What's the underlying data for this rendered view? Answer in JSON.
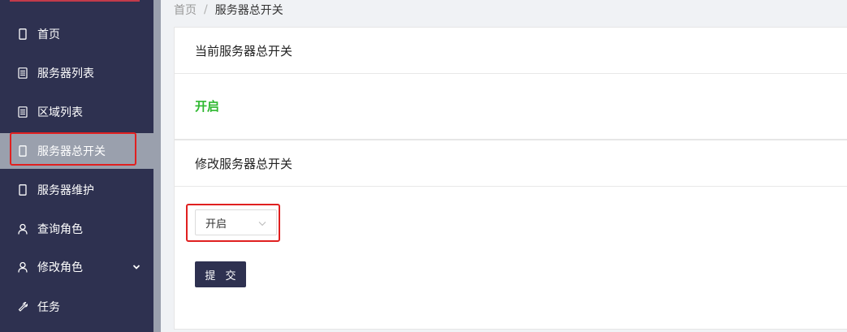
{
  "sidebar": {
    "items": [
      {
        "label": "首页",
        "icon": "phone-icon"
      },
      {
        "label": "服务器列表",
        "icon": "server-list-icon"
      },
      {
        "label": "区域列表",
        "icon": "server-list-icon"
      },
      {
        "label": "服务器总开关",
        "icon": "phone-icon",
        "active": true
      },
      {
        "label": "服务器维护",
        "icon": "phone-icon"
      },
      {
        "label": "查询角色",
        "icon": "user-icon"
      },
      {
        "label": "修改角色",
        "icon": "user-icon",
        "expandable": true
      },
      {
        "label": "任务",
        "icon": "wrench-icon"
      }
    ]
  },
  "breadcrumb": {
    "home": "首页",
    "separator": "/",
    "current": "服务器总开关"
  },
  "current_status_card": {
    "title": "当前服务器总开关",
    "value": "开启"
  },
  "modify_card": {
    "title": "修改服务器总开关",
    "select_value": "开启",
    "submit_label": "提 交"
  },
  "colors": {
    "sidebar_bg": "#2e3150",
    "active_bg": "#9aa0ad",
    "status_green": "#2fb830",
    "highlight_red": "#e02020"
  }
}
